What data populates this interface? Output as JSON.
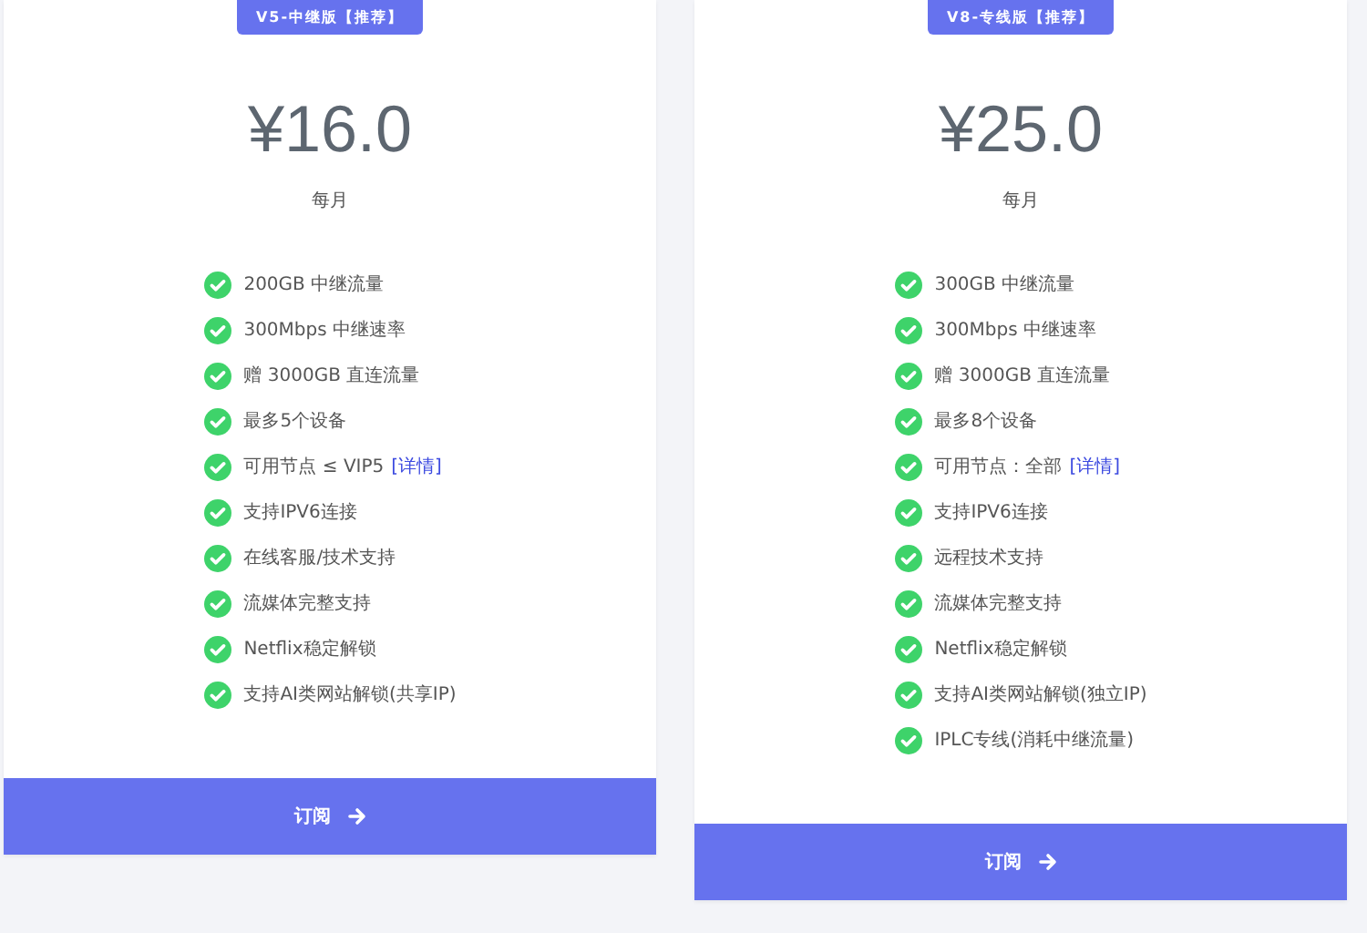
{
  "plans": [
    {
      "badge": "V5-中继版【推荐】",
      "price": "¥16.0",
      "period": "每月",
      "features": [
        {
          "text": "200GB 中继流量"
        },
        {
          "text": "300Mbps 中继速率"
        },
        {
          "text": "赠 3000GB 直连流量"
        },
        {
          "text": "最多5个设备"
        },
        {
          "text": "可用节点 ≤ VIP5",
          "link": "[详情]"
        },
        {
          "text": "支持IPV6连接"
        },
        {
          "text": "在线客服/技术支持"
        },
        {
          "text": "流媒体完整支持"
        },
        {
          "text": "Netflix稳定解锁"
        },
        {
          "text": "支持AI类网站解锁(共享IP)"
        }
      ],
      "button": "订阅"
    },
    {
      "badge": "V8-专线版【推荐】",
      "price": "¥25.0",
      "period": "每月",
      "features": [
        {
          "text": "300GB 中继流量"
        },
        {
          "text": "300Mbps 中继速率"
        },
        {
          "text": "赠 3000GB 直连流量"
        },
        {
          "text": "最多8个设备"
        },
        {
          "text": "可用节点：全部",
          "link": "[详情]"
        },
        {
          "text": "支持IPV6连接"
        },
        {
          "text": "远程技术支持"
        },
        {
          "text": "流媒体完整支持"
        },
        {
          "text": "Netflix稳定解锁"
        },
        {
          "text": "支持AI类网站解锁(独立IP)"
        },
        {
          "text": "IPLC专线(消耗中继流量)"
        }
      ],
      "button": "订阅"
    }
  ]
}
